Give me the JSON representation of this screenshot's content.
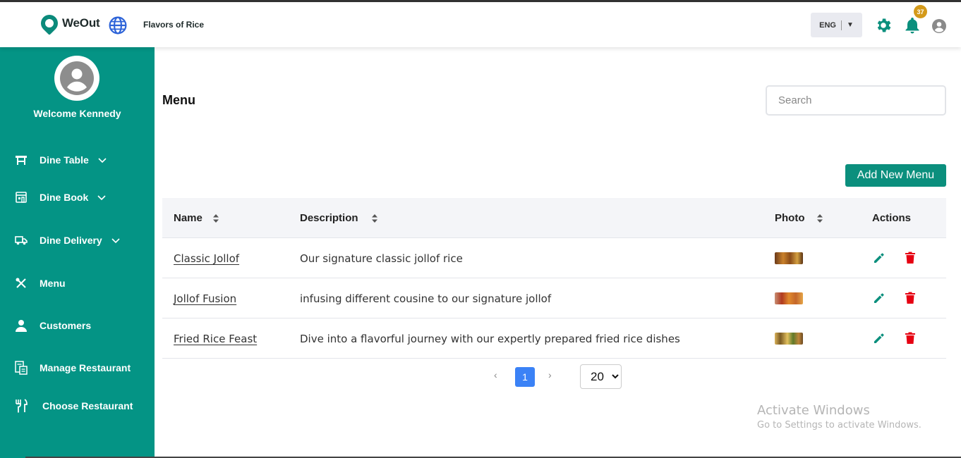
{
  "header": {
    "logo_text": "WeOut",
    "restaurant_name": "Flavors of Rice",
    "language": "ENG",
    "notification_count": "37",
    "accent_color": "#049485"
  },
  "sidebar": {
    "welcome": "Welcome Kennedy",
    "items": [
      {
        "label": "Dine Table",
        "icon": "table-icon",
        "expandable": true
      },
      {
        "label": "Dine Book",
        "icon": "store-icon",
        "expandable": true
      },
      {
        "label": "Dine Delivery",
        "icon": "truck-icon",
        "expandable": true
      },
      {
        "label": "Menu",
        "icon": "utensils-crossed-icon",
        "expandable": false
      },
      {
        "label": "Customers",
        "icon": "person-icon",
        "expandable": false
      },
      {
        "label": "Manage Restaurant",
        "icon": "document-icon",
        "expandable": false
      },
      {
        "label": "Choose Restaurant",
        "icon": "fork-knife-icon",
        "expandable": false
      }
    ]
  },
  "main": {
    "title": "Menu",
    "search_placeholder": "Search",
    "add_button": "Add New Menu",
    "columns": [
      "Name",
      "Description",
      "Photo",
      "Actions"
    ],
    "rows": [
      {
        "name": "Classic Jollof",
        "description": "Our signature classic jollof rice"
      },
      {
        "name": "Jollof Fusion",
        "description": "infusing different cousine to our signature jollof"
      },
      {
        "name": "Fried Rice Feast",
        "description": "Dive into a flavorful journey with our expertly prepared fried rice dishes"
      }
    ],
    "pagination": {
      "prev": "‹",
      "current": "1",
      "next": "›",
      "page_size": "20"
    }
  },
  "watermark": {
    "line1": "Activate Windows",
    "line2": "Go to Settings to activate Windows."
  }
}
